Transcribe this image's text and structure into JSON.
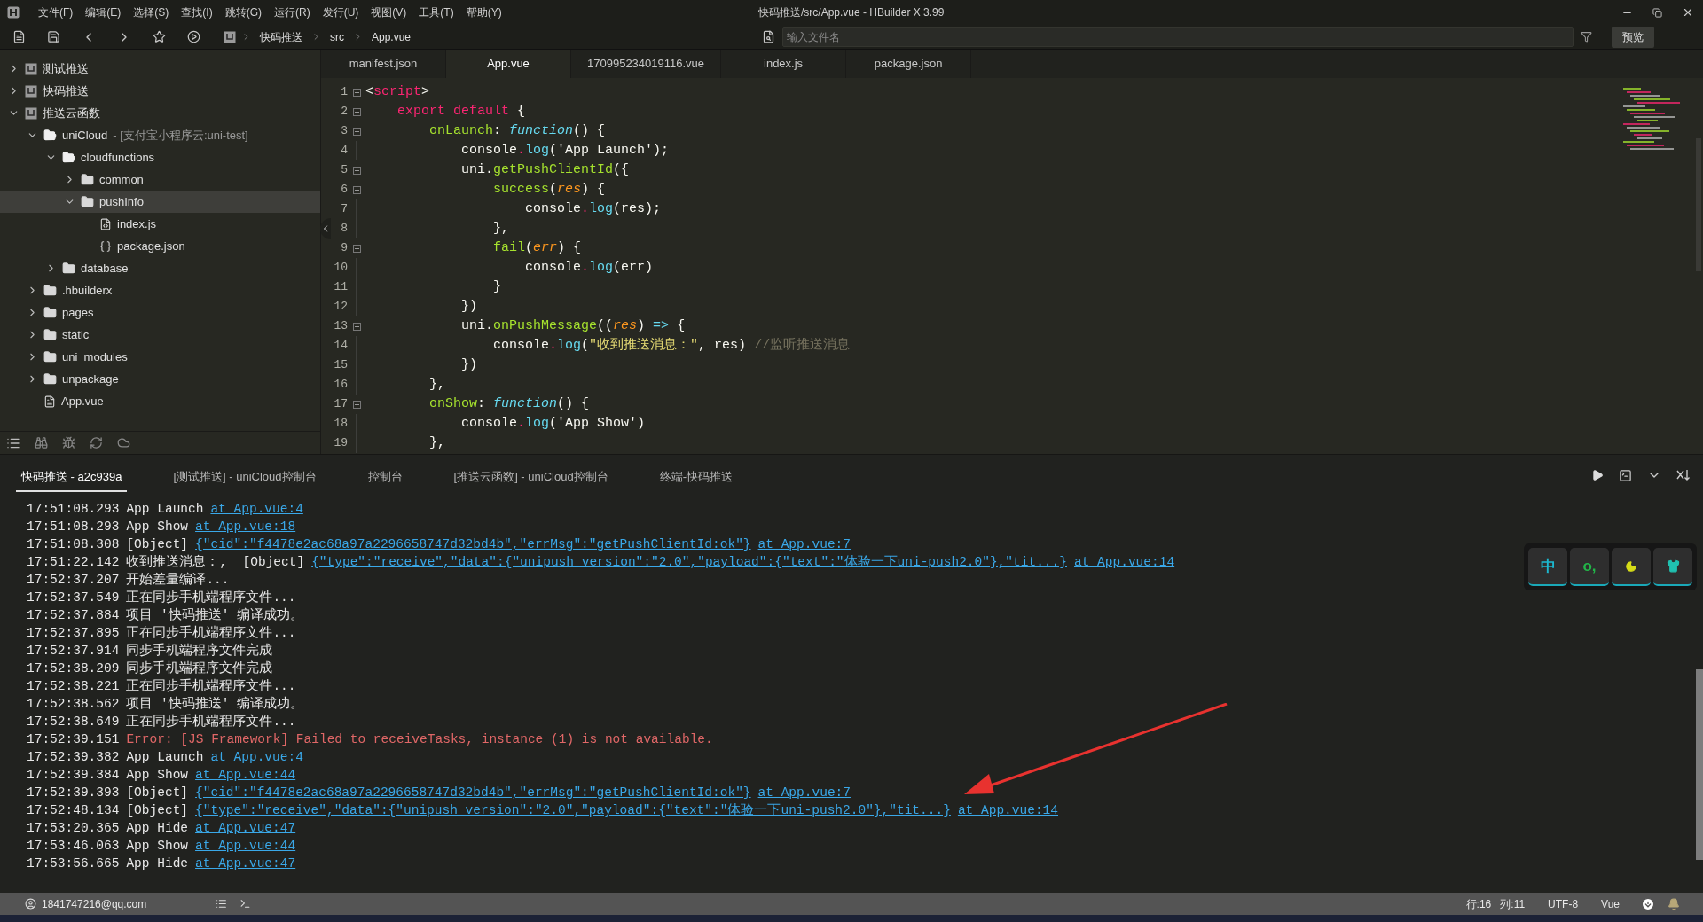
{
  "window": {
    "title": "快码推送/src/App.vue - HBuilder X 3.99"
  },
  "menu": [
    "文件(F)",
    "编辑(E)",
    "选择(S)",
    "查找(I)",
    "跳转(G)",
    "运行(R)",
    "发行(U)",
    "视图(V)",
    "工具(T)",
    "帮助(Y)"
  ],
  "toolbar": {
    "breadcrumb": [
      "快码推送",
      "src",
      "App.vue"
    ],
    "file_search": {
      "placeholder": "输入文件名"
    },
    "preview_button": "预览"
  },
  "sidebar": {
    "tree": [
      {
        "label": "测试推送",
        "kind": "project",
        "expanded": false,
        "selected": false
      },
      {
        "label": "快码推送",
        "kind": "project",
        "expanded": false,
        "selected": false
      },
      {
        "label": "推送云函数",
        "kind": "project",
        "expanded": true,
        "selected": false,
        "children": [
          {
            "label": "uniCloud",
            "note": "- [支付宝小程序云:uni-test]",
            "kind": "cloud-folder",
            "expanded": true,
            "selected": false,
            "children": [
              {
                "label": "cloudfunctions",
                "kind": "cloud-folder",
                "expanded": true,
                "selected": false,
                "children": [
                  {
                    "label": "common",
                    "kind": "folder",
                    "expanded": false,
                    "selected": false
                  },
                  {
                    "label": "pushInfo",
                    "kind": "folder",
                    "expanded": true,
                    "selected": true,
                    "children": [
                      {
                        "label": "index.js",
                        "kind": "js",
                        "selected": false
                      },
                      {
                        "label": "package.json",
                        "kind": "json",
                        "selected": false
                      }
                    ]
                  }
                ]
              },
              {
                "label": "database",
                "kind": "folder",
                "expanded": false,
                "selected": false
              }
            ]
          },
          {
            "label": ".hbuilderx",
            "kind": "folder",
            "expanded": false,
            "selected": false
          },
          {
            "label": "pages",
            "kind": "folder",
            "expanded": false,
            "selected": false
          },
          {
            "label": "static",
            "kind": "folder",
            "expanded": false,
            "selected": false
          },
          {
            "label": "uni_modules",
            "kind": "folder",
            "expanded": false,
            "selected": false
          },
          {
            "label": "unpackage",
            "kind": "folder",
            "expanded": false,
            "selected": false
          },
          {
            "label": "App.vue",
            "kind": "vue",
            "selected": false
          }
        ]
      }
    ]
  },
  "editor": {
    "tabs": [
      {
        "label": "manifest.json",
        "selected": false
      },
      {
        "label": "App.vue",
        "selected": true
      },
      {
        "label": "170995234019116.vue",
        "selected": false
      },
      {
        "label": "index.js",
        "selected": false
      },
      {
        "label": "package.json",
        "selected": false
      }
    ],
    "lines": [
      {
        "number": "1",
        "fold": true,
        "tokens": [
          {
            "text": "<",
            "kind": "plain"
          },
          {
            "text": "script",
            "kind": "tag"
          },
          {
            "text": ">",
            "kind": "plain"
          }
        ]
      },
      {
        "number": "2",
        "fold": true,
        "tokens": [
          {
            "text": "    export default",
            "kind": "keyword"
          },
          {
            "text": " {",
            "kind": "plain"
          }
        ]
      },
      {
        "number": "3",
        "fold": true,
        "tokens": [
          {
            "text": "        onLaunch",
            "kind": "name"
          },
          {
            "text": ": ",
            "kind": "plain"
          },
          {
            "text": "function",
            "kind": "function"
          },
          {
            "text": "() {",
            "kind": "plain"
          }
        ]
      },
      {
        "number": "4",
        "fold": false,
        "tokens": [
          {
            "text": "            console",
            "kind": "plain"
          },
          {
            "text": ".",
            "kind": "dot"
          },
          {
            "text": "log",
            "kind": "method"
          },
          {
            "text": "('App Launch');",
            "kind": "plain"
          }
        ]
      },
      {
        "number": "5",
        "fold": true,
        "tokens": [
          {
            "text": "            uni.",
            "kind": "plain"
          },
          {
            "text": "getPushClientId",
            "kind": "name"
          },
          {
            "text": "({",
            "kind": "plain"
          }
        ]
      },
      {
        "number": "6",
        "fold": true,
        "tokens": [
          {
            "text": "                success",
            "kind": "name"
          },
          {
            "text": "(",
            "kind": "plain"
          },
          {
            "text": "res",
            "kind": "param"
          },
          {
            "text": ") {",
            "kind": "plain"
          }
        ]
      },
      {
        "number": "7",
        "fold": false,
        "tokens": [
          {
            "text": "                    console",
            "kind": "plain"
          },
          {
            "text": ".",
            "kind": "dot"
          },
          {
            "text": "log",
            "kind": "method"
          },
          {
            "text": "(res);",
            "kind": "plain"
          }
        ]
      },
      {
        "number": "8",
        "fold": false,
        "tokens": [
          {
            "text": "                },",
            "kind": "plain"
          }
        ]
      },
      {
        "number": "9",
        "fold": true,
        "tokens": [
          {
            "text": "                fail",
            "kind": "name"
          },
          {
            "text": "(",
            "kind": "plain"
          },
          {
            "text": "err",
            "kind": "param"
          },
          {
            "text": ") {",
            "kind": "plain"
          }
        ]
      },
      {
        "number": "10",
        "fold": false,
        "tokens": [
          {
            "text": "                    console",
            "kind": "plain"
          },
          {
            "text": ".",
            "kind": "dot"
          },
          {
            "text": "log",
            "kind": "method"
          },
          {
            "text": "(err)",
            "kind": "plain"
          }
        ]
      },
      {
        "number": "11",
        "fold": false,
        "tokens": [
          {
            "text": "                }",
            "kind": "plain"
          }
        ]
      },
      {
        "number": "12",
        "fold": false,
        "tokens": [
          {
            "text": "            })",
            "kind": "plain"
          }
        ]
      },
      {
        "number": "13",
        "fold": true,
        "tokens": [
          {
            "text": "            uni.",
            "kind": "plain"
          },
          {
            "text": "onPushMessage",
            "kind": "name"
          },
          {
            "text": "((",
            "kind": "plain"
          },
          {
            "text": "res",
            "kind": "param"
          },
          {
            "text": ") ",
            "kind": "plain"
          },
          {
            "text": "=>",
            "kind": "arrow"
          },
          {
            "text": " {",
            "kind": "plain"
          }
        ]
      },
      {
        "number": "14",
        "fold": false,
        "tokens": [
          {
            "text": "                console",
            "kind": "plain"
          },
          {
            "text": ".",
            "kind": "dot"
          },
          {
            "text": "log",
            "kind": "method"
          },
          {
            "text": "(",
            "kind": "plain"
          },
          {
            "text": "\"收到推送消息：\"",
            "kind": "string"
          },
          {
            "text": ", res) ",
            "kind": "plain"
          },
          {
            "text": "//监听推送消息",
            "kind": "comment"
          }
        ]
      },
      {
        "number": "15",
        "fold": false,
        "tokens": [
          {
            "text": "            })",
            "kind": "plain"
          }
        ]
      },
      {
        "number": "16",
        "fold": false,
        "tokens": [
          {
            "text": "        },",
            "kind": "plain"
          }
        ]
      },
      {
        "number": "17",
        "fold": true,
        "tokens": [
          {
            "text": "        onShow",
            "kind": "name"
          },
          {
            "text": ": ",
            "kind": "plain"
          },
          {
            "text": "function",
            "kind": "function"
          },
          {
            "text": "() {",
            "kind": "plain"
          }
        ]
      },
      {
        "number": "18",
        "fold": false,
        "tokens": [
          {
            "text": "            console",
            "kind": "plain"
          },
          {
            "text": ".",
            "kind": "dot"
          },
          {
            "text": "log",
            "kind": "method"
          },
          {
            "text": "('App Show')",
            "kind": "plain"
          }
        ]
      },
      {
        "number": "19",
        "fold": false,
        "tokens": [
          {
            "text": "        },",
            "kind": "plain"
          }
        ]
      }
    ]
  },
  "console": {
    "tabs": [
      {
        "label": "快码推送 - a2c939a",
        "selected": true
      },
      {
        "label": "[测试推送] - uniCloud控制台",
        "selected": false
      },
      {
        "label": "控制台",
        "selected": false
      },
      {
        "label": "[推送云函数] - uniCloud控制台",
        "selected": false
      },
      {
        "label": "终端-快码推送",
        "selected": false
      }
    ],
    "lines": [
      {
        "time": "17:51:08.293",
        "parts": [
          {
            "text": "App Launch",
            "kind": "plain"
          },
          {
            "text": "at App.vue:4",
            "kind": "link"
          }
        ]
      },
      {
        "time": "17:51:08.293",
        "parts": [
          {
            "text": "App Show",
            "kind": "plain"
          },
          {
            "text": "at App.vue:18",
            "kind": "link"
          }
        ]
      },
      {
        "time": "17:51:08.308",
        "parts": [
          {
            "text": "[Object]",
            "kind": "plain"
          },
          {
            "text": "{\"cid\":\"f4478e2ac68a97a2296658747d32bd4b\",\"errMsg\":\"getPushClientId:ok\"}",
            "kind": "link"
          },
          {
            "text": "at App.vue:7",
            "kind": "link"
          }
        ]
      },
      {
        "time": "17:51:22.142",
        "parts": [
          {
            "text": "收到推送消息：,  [Object]",
            "kind": "plain"
          },
          {
            "text": "{\"type\":\"receive\",\"data\":{\"unipush_version\":\"2.0\",\"payload\":{\"text\":\"体验一下uni-push2.0\"},\"tit...}",
            "kind": "link"
          },
          {
            "text": "at App.vue:14",
            "kind": "link"
          }
        ]
      },
      {
        "time": "17:52:37.207",
        "parts": [
          {
            "text": "开始差量编译...",
            "kind": "plain"
          }
        ]
      },
      {
        "time": "17:52:37.549",
        "parts": [
          {
            "text": "正在同步手机端程序文件...",
            "kind": "plain"
          }
        ]
      },
      {
        "time": "17:52:37.884",
        "parts": [
          {
            "text": "项目 '快码推送' 编译成功。",
            "kind": "plain"
          }
        ]
      },
      {
        "time": "17:52:37.895",
        "parts": [
          {
            "text": "正在同步手机端程序文件...",
            "kind": "plain"
          }
        ]
      },
      {
        "time": "17:52:37.914",
        "parts": [
          {
            "text": "同步手机端程序文件完成",
            "kind": "plain"
          }
        ]
      },
      {
        "time": "17:52:38.209",
        "parts": [
          {
            "text": "同步手机端程序文件完成",
            "kind": "plain"
          }
        ]
      },
      {
        "time": "17:52:38.221",
        "parts": [
          {
            "text": "正在同步手机端程序文件...",
            "kind": "plain"
          }
        ]
      },
      {
        "time": "17:52:38.562",
        "parts": [
          {
            "text": "项目 '快码推送' 编译成功。",
            "kind": "plain"
          }
        ]
      },
      {
        "time": "17:52:38.649",
        "parts": [
          {
            "text": "正在同步手机端程序文件...",
            "kind": "plain"
          }
        ]
      },
      {
        "time": "17:52:39.151",
        "parts": [
          {
            "text": "Error: [JS Framework] Failed to receiveTasks, instance (1) is not available.",
            "kind": "error"
          }
        ]
      },
      {
        "time": "17:52:39.382",
        "parts": [
          {
            "text": "App Launch",
            "kind": "plain"
          },
          {
            "text": "at App.vue:4",
            "kind": "link"
          }
        ]
      },
      {
        "time": "17:52:39.384",
        "parts": [
          {
            "text": "App Show",
            "kind": "plain"
          },
          {
            "text": "at App.vue:44",
            "kind": "link"
          }
        ]
      },
      {
        "time": "17:52:39.393",
        "parts": [
          {
            "text": "[Object]",
            "kind": "plain"
          },
          {
            "text": "{\"cid\":\"f4478e2ac68a97a2296658747d32bd4b\",\"errMsg\":\"getPushClientId:ok\"}",
            "kind": "link"
          },
          {
            "text": "at App.vue:7",
            "kind": "link"
          }
        ]
      },
      {
        "time": "17:52:48.134",
        "parts": [
          {
            "text": "[Object]",
            "kind": "plain"
          },
          {
            "text": "{\"type\":\"receive\",\"data\":{\"unipush_version\":\"2.0\",\"payload\":{\"text\":\"体验一下uni-push2.0\"},\"tit...}",
            "kind": "link"
          },
          {
            "text": "at App.vue:14",
            "kind": "link"
          }
        ]
      },
      {
        "time": "17:53:20.365",
        "parts": [
          {
            "text": "App Hide",
            "kind": "plain"
          },
          {
            "text": "at App.vue:47",
            "kind": "link"
          }
        ]
      },
      {
        "time": "17:53:46.063",
        "parts": [
          {
            "text": "App Show",
            "kind": "plain"
          },
          {
            "text": "at App.vue:44",
            "kind": "link"
          }
        ]
      },
      {
        "time": "17:53:56.665",
        "parts": [
          {
            "text": "App Hide",
            "kind": "plain"
          },
          {
            "text": "at App.vue:47",
            "kind": "link"
          }
        ]
      }
    ]
  },
  "ime": {
    "keys": [
      {
        "kind": "text",
        "text": "中"
      },
      {
        "kind": "text",
        "text": "o,"
      },
      {
        "kind": "moon"
      },
      {
        "kind": "shirt"
      }
    ]
  },
  "status_bar": {
    "user": "1841747216@qq.com",
    "line": "行:16",
    "column": "列:11",
    "encoding": "UTF-8",
    "language": "Vue"
  }
}
